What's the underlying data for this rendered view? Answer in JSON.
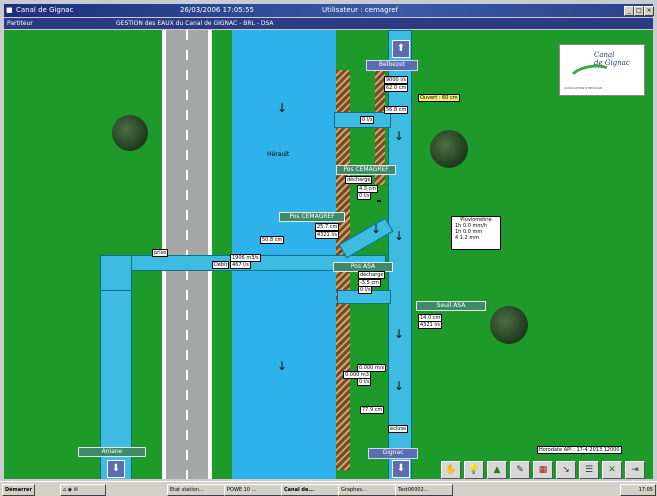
{
  "window": {
    "title": "Canal de Gignac",
    "datetime": "26/03/2006 17:05:55",
    "user": "Utilisateur : cemagref"
  },
  "menubar": {
    "left": "Partiteur",
    "center": "GESTION des EAUX du Canal de GIGNAC - BRL - DSA"
  },
  "map": {
    "herault": "Hérault",
    "arrow_down": "↓",
    "arrow_up": "⬆",
    "belbezet": "Belbezet",
    "gignac": "Gignac",
    "aniane": "Aniane",
    "pos_cemagref_1": "Pos CEMAGREF",
    "pos_cemagref_2": "Pos CEMAGREF",
    "pos_asa": "Pos ASA",
    "seuil_asa": "Seuil ASA",
    "decharge_1": "décharge",
    "decharge_2": "décharge",
    "belbezet_values": [
      "9000 l/s",
      "62.0 cm"
    ],
    "val_568": "56.8 cm",
    "val_01": "0 l/s",
    "ouvert": "Ouvert : 60 cm",
    "cem_vals": [
      "4.3 cm",
      "0 l/s"
    ],
    "cem2_vals": [
      "25.7 cm",
      "4321 l/s"
    ],
    "val_508": "50.8 cm",
    "prise_label": "prise",
    "prise_vals": [
      "1906 m3/s",
      "467 l/s"
    ],
    "prise_prefix": "Débit",
    "asa_vals": [
      "-3.5 cm",
      "0 l/s"
    ],
    "seuil_vals": [
      "14.0 cm",
      "4321 l/s"
    ],
    "pluvio": {
      "title": "Pluviométrie",
      "rows": [
        [
          "1h",
          "0.0 mm/h"
        ],
        [
          "1h",
          "0.0 mm"
        ],
        [
          "4",
          "1.2 mm"
        ]
      ]
    },
    "bottom_vals": [
      "0.000 m/s",
      "0.000 m3",
      "0 l/s",
      "77.9 cm"
    ],
    "ecluse": "écluse",
    "horodate": "Horodate API :  17-4      2013  12000"
  },
  "logo": {
    "line1": "Canal",
    "line2": "de Gignac",
    "line3": "ASSOCIATION SYNDICALE"
  },
  "taskbar": {
    "start": "Démarrer",
    "items": [
      "Etat station...",
      "POWE 10 ...",
      "Canal de...",
      "Graphes...",
      "Test06002..."
    ],
    "clock": "17:05"
  },
  "tools": [
    "camera-icon",
    "bulb-icon",
    "triangle-icon",
    "pencil-icon",
    "chart-icon",
    "tool-icon",
    "list-icon",
    "excel-icon",
    "exit-icon"
  ]
}
